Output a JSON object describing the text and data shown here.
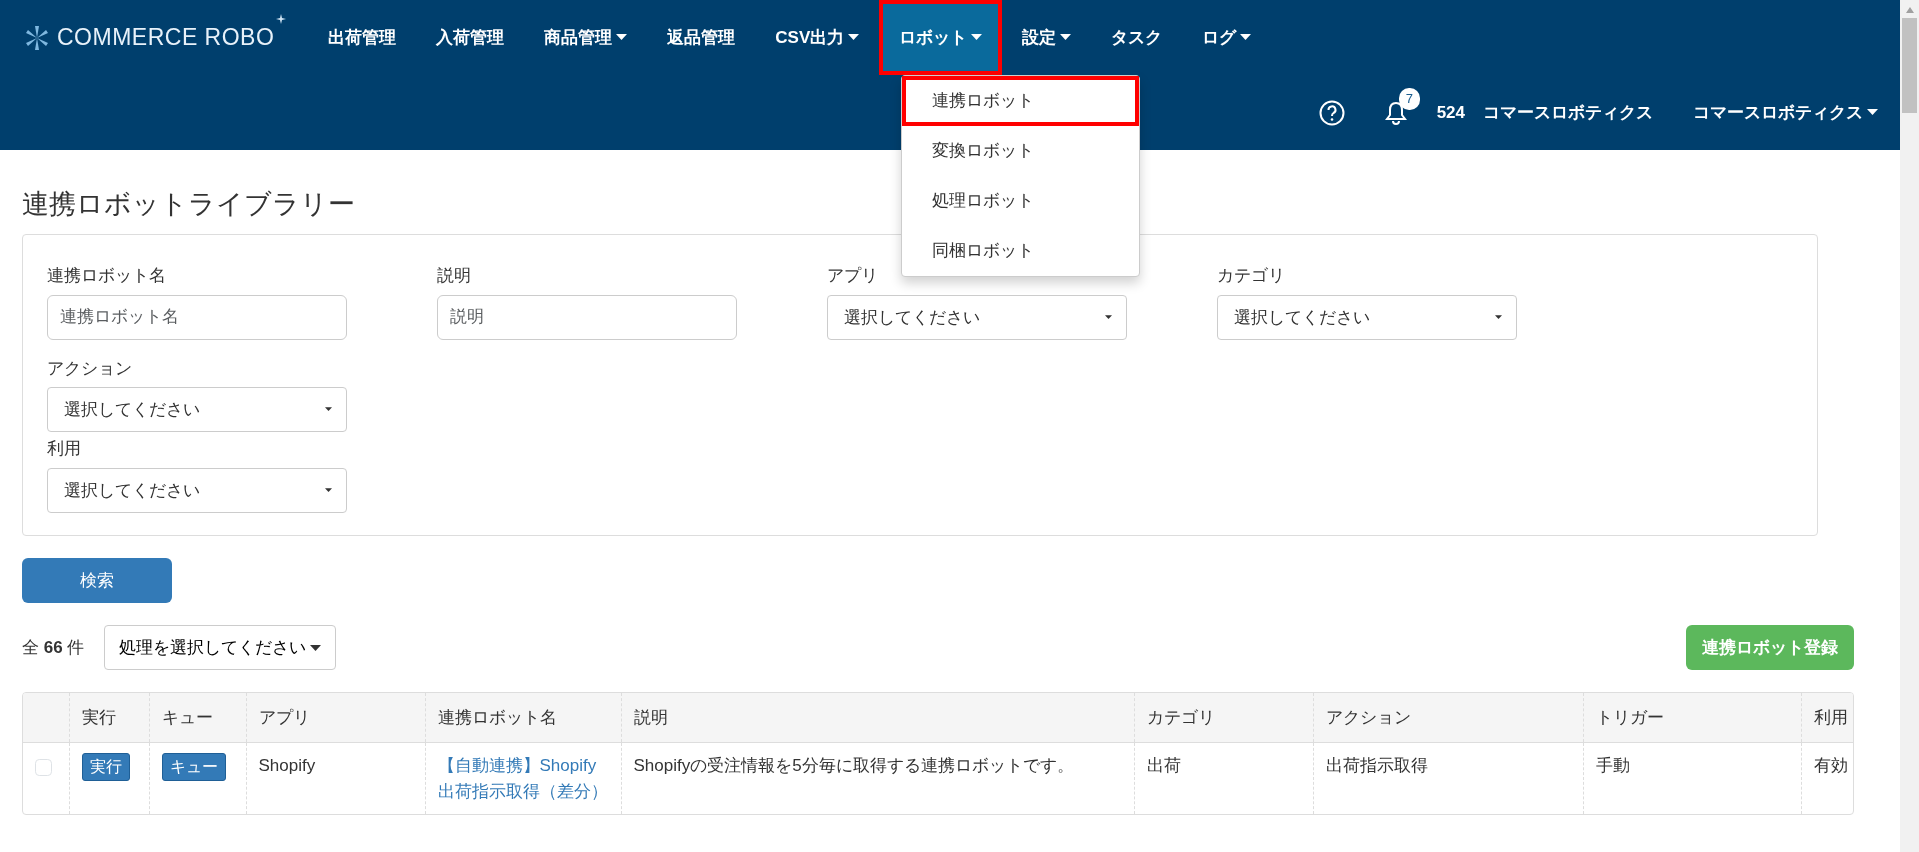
{
  "header": {
    "logo": "COMMERCE ROBO",
    "nav": [
      {
        "label": "出荷管理",
        "caret": false,
        "selected": false,
        "annotated": false
      },
      {
        "label": "入荷管理",
        "caret": false,
        "selected": false,
        "annotated": false
      },
      {
        "label": "商品管理",
        "caret": true,
        "selected": false,
        "annotated": false
      },
      {
        "label": "返品管理",
        "caret": false,
        "selected": false,
        "annotated": false
      },
      {
        "label": "CSV出力",
        "caret": true,
        "selected": false,
        "annotated": false
      },
      {
        "label": "ロボット",
        "caret": true,
        "selected": true,
        "annotated": true
      },
      {
        "label": "設定",
        "caret": true,
        "selected": false,
        "annotated": false
      },
      {
        "label": "タスク",
        "caret": false,
        "selected": false,
        "annotated": false
      },
      {
        "label": "ログ",
        "caret": true,
        "selected": false,
        "annotated": false
      }
    ],
    "dropdown": [
      {
        "label": "連携ロボット",
        "annotated": true
      },
      {
        "label": "変換ロボット",
        "annotated": false
      },
      {
        "label": "処理ロボット",
        "annotated": false
      },
      {
        "label": "同梱ロボット",
        "annotated": false
      }
    ],
    "notification_count": "7",
    "account_id": "524",
    "account_name": "コマースロボティクス",
    "user_menu": "コマースロボティクス"
  },
  "page_title": "連携ロボットライブラリー",
  "filters": [
    {
      "label": "連携ロボット名",
      "kind": "text",
      "placeholder": "連携ロボット名"
    },
    {
      "label": "説明",
      "kind": "text",
      "placeholder": "説明"
    },
    {
      "label": "アプリ",
      "kind": "select",
      "value": "選択してください"
    },
    {
      "label": "カテゴリ",
      "kind": "select",
      "value": "選択してください"
    },
    {
      "label": "アクション",
      "kind": "select",
      "value": "選択してください"
    },
    {
      "label": "利用",
      "kind": "select",
      "value": "選択してください"
    }
  ],
  "search_button": "検索",
  "total": {
    "prefix": "全",
    "count": "66",
    "suffix": "件"
  },
  "bulk_action": "処理を選択してください",
  "register_button": "連携ロボット登録",
  "table": {
    "columns": [
      "実行",
      "キュー",
      "アプリ",
      "連携ロボット名",
      "説明",
      "カテゴリ",
      "アクション",
      "トリガー",
      "利用"
    ],
    "rows": [
      {
        "checked": false,
        "run": "実行",
        "queue": "キュー",
        "app": "Shopify",
        "name": "【自動連携】Shopify 出荷指示取得（差分）",
        "description": "Shopifyの受注情報を5分毎に取得する連携ロボットです。",
        "category": "出荷",
        "action": "出荷指示取得",
        "trigger": "手動",
        "usage": "有効"
      }
    ]
  }
}
